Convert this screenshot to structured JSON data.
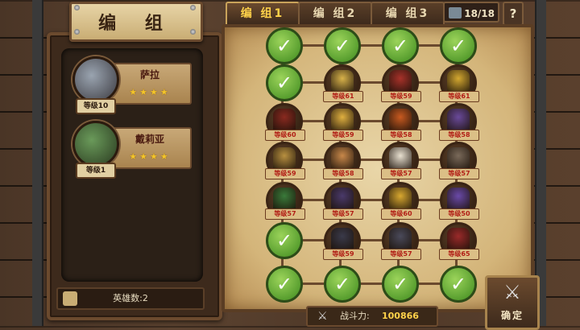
{
  "screen_title": "编 组",
  "tabs": [
    {
      "label": "编 组1",
      "active": true
    },
    {
      "label": "编 组2",
      "active": false
    },
    {
      "label": "编 组3",
      "active": false
    }
  ],
  "troop_counter": "18/18",
  "help_label": "?",
  "heroes": [
    {
      "name": "萨拉",
      "level": "等级10",
      "stars": "★★★★"
    },
    {
      "name": "戴莉亚",
      "level": "等级1",
      "stars": "★★★★"
    }
  ],
  "hero_count": "英雄数:2",
  "power": {
    "label": "战斗力:",
    "value": "100866"
  },
  "confirm_label": "确定",
  "grid": [
    [
      {
        "empty": true
      },
      {
        "empty": true
      },
      {
        "empty": true
      },
      {
        "empty": true
      }
    ],
    [
      {
        "empty": true
      },
      {
        "empty": false,
        "level": "等级61",
        "color": "#d8b24a"
      },
      {
        "empty": false,
        "level": "等级59",
        "color": "#a8322a"
      },
      {
        "empty": false,
        "level": "等级61",
        "color": "#d4a830"
      }
    ],
    [
      {
        "empty": false,
        "level": "等级60",
        "color": "#8a2a20"
      },
      {
        "empty": false,
        "level": "等级59",
        "color": "#e0b040"
      },
      {
        "empty": false,
        "level": "等级58",
        "color": "#c85a20"
      },
      {
        "empty": false,
        "level": "等级58",
        "color": "#6a4a9a"
      }
    ],
    [
      {
        "empty": false,
        "level": "等级59",
        "color": "#b89040"
      },
      {
        "empty": false,
        "level": "等级58",
        "color": "#c8884a"
      },
      {
        "empty": false,
        "level": "等级57",
        "color": "#e8e0d0"
      },
      {
        "empty": false,
        "level": "等级57",
        "color": "#7a6a5a"
      }
    ],
    [
      {
        "empty": false,
        "level": "等级57",
        "color": "#3a7a3a"
      },
      {
        "empty": false,
        "level": "等级57",
        "color": "#4a3a6a"
      },
      {
        "empty": false,
        "level": "等级60",
        "color": "#d8a830"
      },
      {
        "empty": false,
        "level": "等级50",
        "color": "#6a4aa8"
      }
    ],
    [
      {
        "empty": true
      },
      {
        "empty": false,
        "level": "等级59",
        "color": "#3a3a4a"
      },
      {
        "empty": false,
        "level": "等级57",
        "color": "#4a4a5a"
      },
      {
        "empty": false,
        "level": "等级65",
        "color": "#9a2a2a"
      }
    ],
    [
      {
        "empty": true
      },
      {
        "empty": true
      },
      {
        "empty": true
      },
      {
        "empty": true
      }
    ]
  ],
  "icons": {
    "check": "check-icon",
    "swords": "crossed-swords-icon",
    "troops": "troops-icon",
    "hero": "hero-helmet-icon"
  }
}
